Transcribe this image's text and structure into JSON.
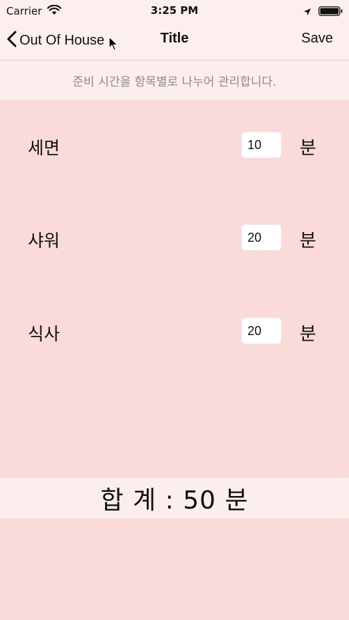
{
  "status_bar": {
    "carrier": "Carrier",
    "time": "3:25 PM",
    "icons": [
      "wifi-icon",
      "location-arrow-icon",
      "battery-icon"
    ]
  },
  "nav": {
    "back_label": "Out Of House",
    "title": "Title",
    "save_label": "Save"
  },
  "description": "준비 시간을 항목별로 나누어 관리합니다.",
  "items": [
    {
      "label": "세면",
      "value": "10",
      "unit": "분"
    },
    {
      "label": "샤워",
      "value": "20",
      "unit": "분"
    },
    {
      "label": "식사",
      "value": "20",
      "unit": "분"
    }
  ],
  "total_text": "합 계 : 50 분",
  "colors": {
    "background": "#fadbd9",
    "bar_background": "#fcefee",
    "description_text": "#8a8a8a"
  }
}
